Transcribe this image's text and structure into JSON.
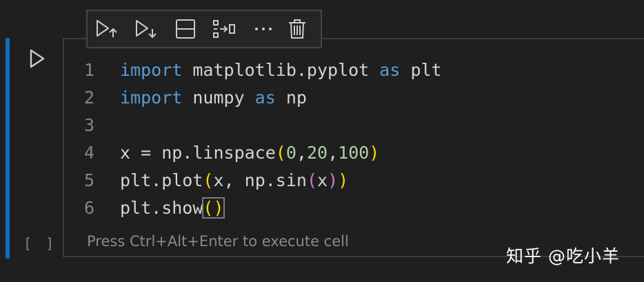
{
  "toolbar": {
    "icons": [
      "run-above-icon",
      "run-below-icon",
      "split-cell-icon",
      "join-cells-icon",
      "more-icon",
      "delete-icon"
    ]
  },
  "cell": {
    "execution_count": "[ ]",
    "run_icon": "play-icon",
    "hint": "Press Ctrl+Alt+Enter to execute cell",
    "lines": [
      {
        "n": "1",
        "tokens": [
          {
            "t": "import",
            "c": "kw"
          },
          {
            "t": " matplotlib.pyplot ",
            "c": ""
          },
          {
            "t": "as",
            "c": "kw"
          },
          {
            "t": " plt",
            "c": ""
          }
        ]
      },
      {
        "n": "2",
        "tokens": [
          {
            "t": "import",
            "c": "kw"
          },
          {
            "t": " numpy ",
            "c": ""
          },
          {
            "t": "as",
            "c": "kw"
          },
          {
            "t": " np",
            "c": ""
          }
        ]
      },
      {
        "n": "3",
        "tokens": []
      },
      {
        "n": "4",
        "tokens": [
          {
            "t": "x = np.linspace",
            "c": ""
          },
          {
            "t": "(",
            "c": "p1"
          },
          {
            "t": "0",
            "c": "num"
          },
          {
            "t": ",",
            "c": ""
          },
          {
            "t": "20",
            "c": "num"
          },
          {
            "t": ",",
            "c": ""
          },
          {
            "t": "100",
            "c": "num"
          },
          {
            "t": ")",
            "c": "p1"
          }
        ]
      },
      {
        "n": "5",
        "tokens": [
          {
            "t": "plt.plot",
            "c": ""
          },
          {
            "t": "(",
            "c": "p1"
          },
          {
            "t": "x, np.sin",
            "c": ""
          },
          {
            "t": "(",
            "c": "p2"
          },
          {
            "t": "x",
            "c": ""
          },
          {
            "t": ")",
            "c": "p2"
          },
          {
            "t": ")",
            "c": "p1"
          }
        ]
      },
      {
        "n": "6",
        "tokens": [
          {
            "t": "plt.show",
            "c": ""
          },
          {
            "t": "()",
            "c": "p1 cursor-box"
          }
        ]
      }
    ]
  },
  "watermark": "知乎 @吃小羊",
  "colors": {
    "background": "#1f1f1f",
    "focus_bar": "#0e6fc0",
    "keyword": "#569cd6",
    "number": "#b5cea8",
    "bracket_1": "#ffd700",
    "bracket_2": "#da70d6"
  }
}
